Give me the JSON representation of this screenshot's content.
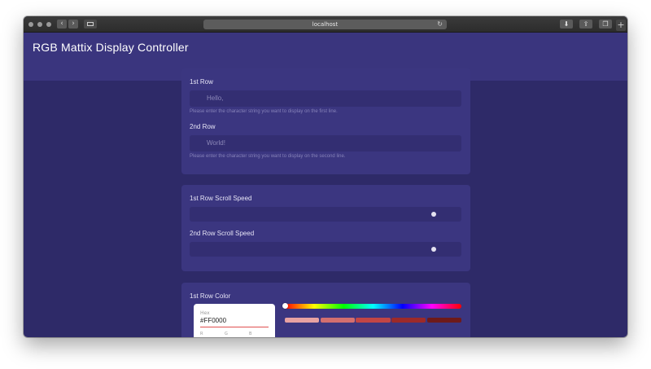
{
  "browser": {
    "url": "localhost",
    "back_glyph": "‹",
    "forward_glyph": "›",
    "reload_glyph": "↻",
    "download_glyph": "⬇",
    "share_glyph": "⇪",
    "tabs_glyph": "❐",
    "new_tab_glyph": "+"
  },
  "app": {
    "title": "RGB Mattix Display Controller"
  },
  "text_card": {
    "row1_label": "1st Row",
    "row1_placeholder": "Hello,",
    "row1_hint": "Please enter the character string you want to display on the first line.",
    "row2_label": "2nd Row",
    "row2_placeholder": "World!",
    "row2_hint": "Please enter the character string you want to display on the second line."
  },
  "speed_card": {
    "row1_label": "1st Row Scroll Speed",
    "row1_value_fraction": 0.92,
    "row2_label": "2nd Row Scroll Speed",
    "row2_value_fraction": 0.92
  },
  "color_card": {
    "label": "1st Row Color",
    "picker": {
      "hex_label": "Hex",
      "hex_value": "#FF0000",
      "r_label": "R",
      "g_label": "G",
      "b_label": "B"
    },
    "hue_fraction": 0.0,
    "swatches": [
      "#e8a2a2",
      "#d36f6f",
      "#c24545",
      "#9c2a2a",
      "#6e1a1a"
    ]
  },
  "colors": {
    "page_background": "#2e2a68",
    "header": "#3a357e",
    "card": "#3b3680",
    "field": "#332e72"
  }
}
